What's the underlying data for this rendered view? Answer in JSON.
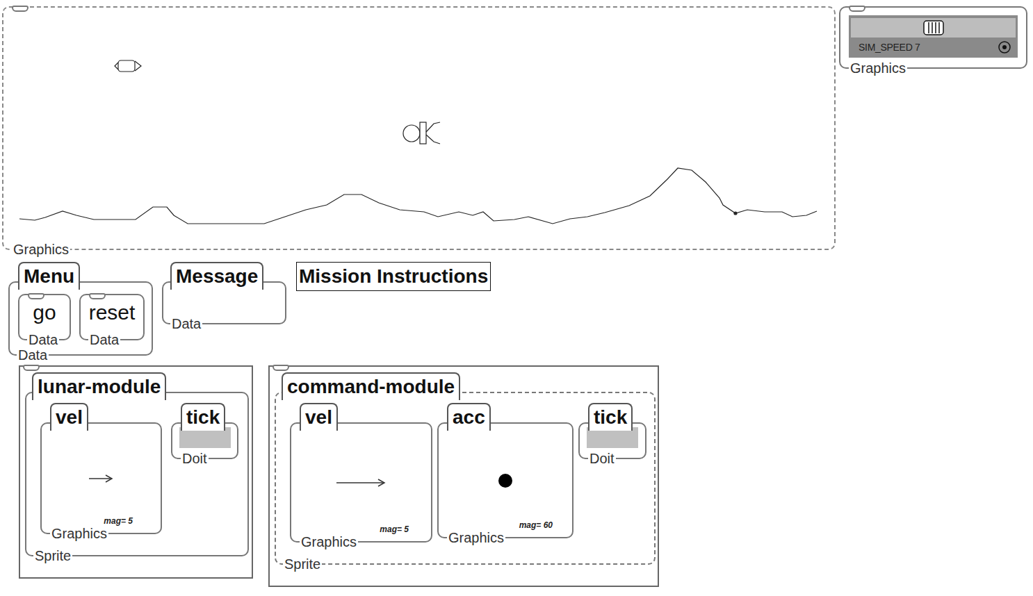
{
  "world": {
    "label": "Graphics"
  },
  "speed": {
    "text": "SIM_SPEED 7",
    "label": "Graphics"
  },
  "menu": {
    "title": "Menu",
    "label": "Data",
    "buttons": [
      {
        "text": "go",
        "label": "Data"
      },
      {
        "text": "reset",
        "label": "Data"
      }
    ]
  },
  "message": {
    "title": "Message",
    "label": "Data"
  },
  "instructions": {
    "text": "Mission Instructions"
  },
  "modules": [
    {
      "title": "lunar-module",
      "label": "Sprite",
      "kind": "solid",
      "slots": [
        {
          "title": "vel",
          "label": "Graphics",
          "kind": "vector",
          "magnitude": "mag= 5"
        },
        {
          "title": "tick",
          "label": "Doit",
          "kind": "doit"
        }
      ]
    },
    {
      "title": "command-module",
      "label": "Sprite",
      "kind": "dashed",
      "slots": [
        {
          "title": "vel",
          "label": "Graphics",
          "kind": "vector",
          "magnitude": "mag= 5"
        },
        {
          "title": "acc",
          "label": "Graphics",
          "kind": "point",
          "magnitude": "mag= 60"
        },
        {
          "title": "tick",
          "label": "Doit",
          "kind": "doit"
        }
      ]
    }
  ]
}
